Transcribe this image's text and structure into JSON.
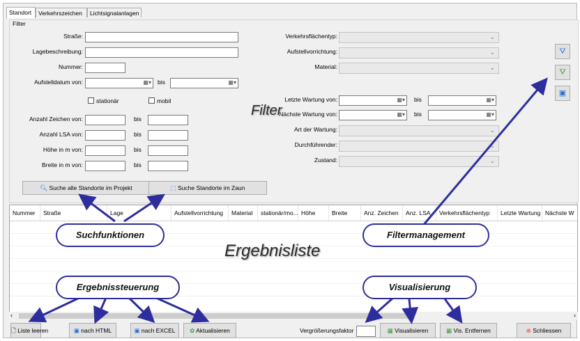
{
  "tabs": [
    "Standort",
    "Verkehrszeichen",
    "Lichtsignalanlagen"
  ],
  "filter_group": "Filter",
  "left_fields": {
    "strasse": "Straße:",
    "lagebeschreibung": "Lagebeschreibung:",
    "nummer": "Nummer:",
    "aufstelldatum": "Aufstelldatum von:",
    "bis": "bis",
    "stationaer": "stationär",
    "mobil": "mobil",
    "anzahl_zeichen": "Anzahl Zeichen von:",
    "anzahl_lsa": "Anzahl LSA von:",
    "hoehe": "Höhe in m von:",
    "breite": "Breite in m von:"
  },
  "right_fields": {
    "verkehrsflaechentyp": "Verkehrsflächentyp:",
    "aufstellvorrichtung": "Aufstellvorrichtung:",
    "material": "Material:",
    "letzte_wartung": "Letzte Wartung von:",
    "naechste_wartung": "Nächste Wartung von:",
    "art_der_wartung": "Art der Wartung:",
    "durchfuehrender": "Durchführender:",
    "zustand": "Zustand:",
    "bis": "bis"
  },
  "search_buttons": {
    "alle": "Suche alle Standorte im Projekt",
    "zaun": "Suche Standorte im Zaun"
  },
  "columns": [
    "Nummer",
    "Straße",
    "Lage",
    "Aufstellvorrichtung",
    "Material",
    "stationär/mo...",
    "Höhe",
    "Breite",
    "Anz. Zeichen",
    "Anz. LSA",
    "Verkehrsflächentyp",
    "Letzte Wartung",
    "Nächste W"
  ],
  "bottom": {
    "liste_leeren": "Liste leeren",
    "nach_html": "nach HTML",
    "nach_excel": "nach EXCEL",
    "aktualisieren": "Aktualisieren",
    "vergroesserungsfaktor": "Vergrößerungsfaktor",
    "visualisieren": "Visualisieren",
    "vis_entfernen": "Vis. Entfernen",
    "schliessen": "Schliessen"
  },
  "annotations": {
    "filter": "Filter",
    "suchfunktionen": "Suchfunktionen",
    "filtermanagement": "Filtermanagement",
    "ergebnisliste": "Ergebnisliste",
    "ergebnissteuerung": "Ergebnissteuerung",
    "visualisierung": "Visualisierung"
  },
  "colors": {
    "annotation_arrow": "#2d2d9e",
    "close_icon": "#e0453a"
  },
  "icons": [
    "search-icon",
    "zone-search-icon",
    "filter-clear-icon",
    "filter-load-icon",
    "filter-save-icon",
    "page-icon",
    "html-icon",
    "excel-icon",
    "refresh-icon",
    "visualize-icon",
    "visualize-remove-icon",
    "close-icon",
    "calendar-icon",
    "chevron-down-icon"
  ]
}
